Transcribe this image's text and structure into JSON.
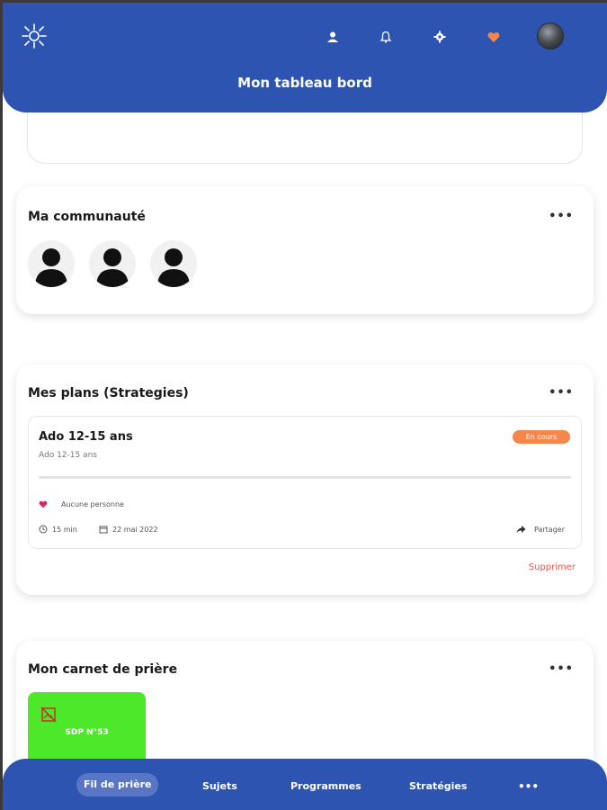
{
  "header": {
    "title": "Mon tableau bord",
    "icons": [
      "sun-logo-icon",
      "person-icon",
      "bell-icon",
      "gear-icon",
      "heart-icon",
      "user-avatar"
    ],
    "accent": "#2e54b2",
    "heart_color": "#f5874b"
  },
  "community": {
    "title": "Ma communauté",
    "more": "•••",
    "members": [
      "member-1",
      "member-2",
      "member-3"
    ]
  },
  "plans": {
    "title": "Mes plans (Strategies)",
    "more": "•••",
    "item": {
      "title": "Ado 12-15 ans",
      "subtitle": "Ado 12-15 ans",
      "status": "En cours",
      "progress": 0,
      "people": "Aucune personne",
      "duration": "15 min",
      "date": "22 mai 2022",
      "share": "Partager"
    },
    "delete": "Supprimer"
  },
  "notebook": {
    "title": "Mon carnet de prière",
    "more": "•••",
    "tile_label": "SDP N°53",
    "tile_color": "#4ee82b"
  },
  "bottom_nav": {
    "items": [
      "Fil de prière",
      "Sujets",
      "Programmes",
      "Stratégies",
      "•••"
    ]
  }
}
